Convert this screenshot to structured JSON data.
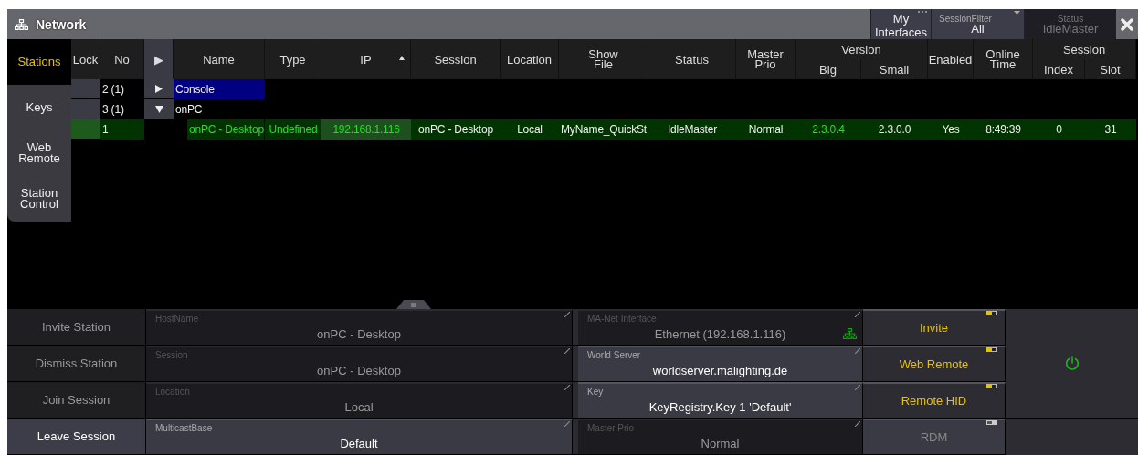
{
  "window": {
    "title": "Network"
  },
  "header_controls": {
    "interfaces": {
      "label": "My Interfaces"
    },
    "session_filter": {
      "label": "SessionFilter",
      "value": "All"
    },
    "status": {
      "label": "Status",
      "value": "IdleMaster",
      "disabled": true
    }
  },
  "tabs": [
    {
      "label": "Stations",
      "selected": true
    },
    {
      "label": "Keys",
      "selected": false
    },
    {
      "label": "Web Remote",
      "selected": false
    },
    {
      "label": "Station Control",
      "selected": false
    }
  ],
  "table": {
    "columns": [
      {
        "kind": "column",
        "label": "Lock",
        "sorted": false
      },
      {
        "kind": "column",
        "label": "No",
        "sorted": false
      },
      {
        "kind": "column",
        "label": "▶",
        "sorted": false
      },
      {
        "kind": "column",
        "label": "Name",
        "sorted": false
      },
      {
        "kind": "column",
        "label": "Type",
        "sorted": false
      },
      {
        "kind": "column",
        "label": "IP",
        "sorted": true
      },
      {
        "kind": "column",
        "label": "Session",
        "sorted": false
      },
      {
        "kind": "column",
        "label": "Location",
        "sorted": false
      },
      {
        "kind": "column",
        "label": "Show File",
        "sorted": false
      },
      {
        "kind": "column",
        "label": "Status",
        "sorted": false
      },
      {
        "kind": "column",
        "label": "Master Prio",
        "sorted": false
      },
      {
        "kind": "group",
        "label": "Version",
        "columns": [
          {
            "label": "Big",
            "sorted": false
          },
          {
            "label": "Small",
            "sorted": false
          }
        ]
      },
      {
        "kind": "column",
        "label": "Enabled",
        "sorted": false
      },
      {
        "kind": "column",
        "label": "Online Time",
        "sorted": false
      },
      {
        "kind": "group",
        "label": "Session",
        "columns": [
          {
            "label": "Index",
            "sorted": false
          },
          {
            "label": "Slot",
            "sorted": false
          }
        ]
      }
    ],
    "rows": [
      {
        "no": "2 (1)",
        "name": "Console",
        "selected": true,
        "expanded": false
      },
      {
        "no": "3 (1)",
        "name": "onPC",
        "selected": false,
        "expanded": true,
        "children": [
          {
            "no": "1",
            "online": true,
            "cells": [
              {
                "text": "onPC - Desktop",
                "accent": true
              },
              {
                "text": "Undefined",
                "accent": true
              },
              {
                "text": "192.168.1.116",
                "accent": true
              },
              {
                "text": "onPC - Desktop",
                "accent": false
              },
              {
                "text": "Local",
                "accent": false
              },
              {
                "text": "MyName_QuickSt",
                "accent": false
              },
              {
                "text": "IdleMaster",
                "accent": false
              },
              {
                "text": "Normal",
                "accent": false
              },
              {
                "text": "2.3.0.4",
                "accent": true
              },
              {
                "text": "2.3.0.0",
                "accent": false
              },
              {
                "text": "Yes",
                "accent": false
              },
              {
                "text": "8:49:39",
                "accent": false
              },
              {
                "text": "0",
                "accent": false
              },
              {
                "text": "31",
                "accent": false
              }
            ]
          }
        ]
      }
    ]
  },
  "actions": [
    {
      "label": "Invite Station",
      "disabled": true
    },
    {
      "label": "Dismiss Station",
      "disabled": true
    },
    {
      "label": "Join Session",
      "disabled": true
    },
    {
      "label": "Leave Session",
      "disabled": false
    }
  ],
  "fields": [
    {
      "label": "HostName",
      "value": "onPC - Desktop",
      "disabled": true
    },
    {
      "label": "Session",
      "value": "onPC - Desktop",
      "disabled": true
    },
    {
      "label": "Location",
      "value": "Local",
      "disabled": true
    },
    {
      "label": "MulticastBase",
      "value": "Default",
      "disabled": false
    }
  ],
  "settings": [
    {
      "label": "MA-Net Interface",
      "value": "Ethernet (192.168.1.116)",
      "disabled": true
    },
    {
      "label": "World Server",
      "value": "worldserver.malighting.de",
      "disabled": false
    },
    {
      "label": "Key",
      "value": "KeyRegistry.Key 1 'Default'",
      "disabled": false
    },
    {
      "label": "Master Prio",
      "value": "Normal",
      "disabled": true
    }
  ],
  "toggles": [
    {
      "label": "Invite",
      "on": true
    },
    {
      "label": "Web Remote",
      "on": true
    },
    {
      "label": "Remote HID",
      "on": true
    },
    {
      "label": "RDM",
      "on": false
    }
  ],
  "power": {
    "on": true
  }
}
